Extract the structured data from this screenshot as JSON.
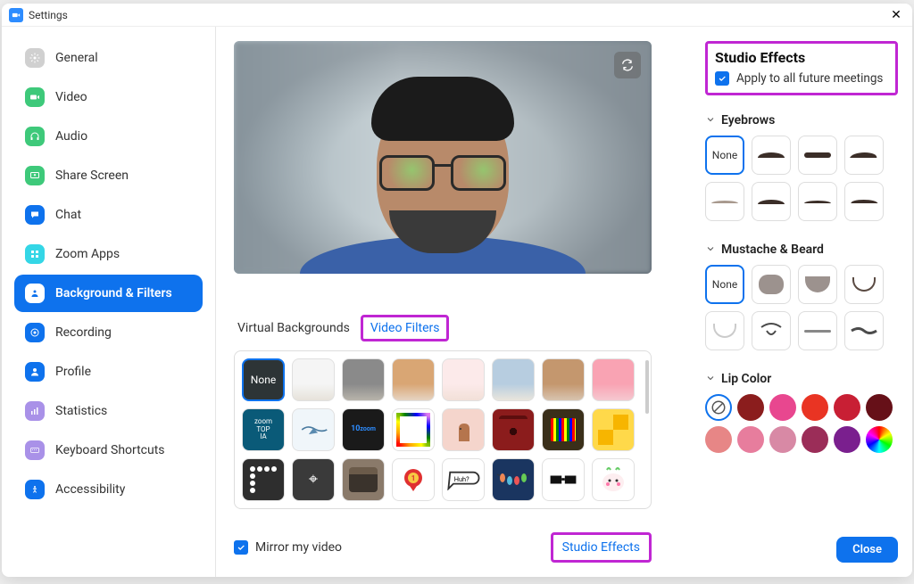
{
  "window": {
    "title": "Settings"
  },
  "sidebar": {
    "items": [
      {
        "label": "General"
      },
      {
        "label": "Video"
      },
      {
        "label": "Audio"
      },
      {
        "label": "Share Screen"
      },
      {
        "label": "Chat"
      },
      {
        "label": "Zoom Apps"
      },
      {
        "label": "Background & Filters"
      },
      {
        "label": "Recording"
      },
      {
        "label": "Profile"
      },
      {
        "label": "Statistics"
      },
      {
        "label": "Keyboard Shortcuts"
      },
      {
        "label": "Accessibility"
      }
    ]
  },
  "tabs": {
    "virtual_backgrounds": "Virtual Backgrounds",
    "video_filters": "Video Filters"
  },
  "filters": {
    "none_label": "None"
  },
  "mirror": {
    "label": "Mirror my video",
    "checked": true
  },
  "studio_link": "Studio Effects",
  "effects": {
    "title": "Studio Effects",
    "apply_label": "Apply to all future meetings",
    "apply_checked": true,
    "sections": {
      "eyebrows": {
        "title": "Eyebrows",
        "none": "None"
      },
      "mustache": {
        "title": "Mustache & Beard",
        "none": "None"
      },
      "lipcolor": {
        "title": "Lip Color"
      }
    },
    "lip_colors": [
      "#8b1d1d",
      "#e8478f",
      "#e93423",
      "#c81f34",
      "#661018",
      "#e78686",
      "#e77d9d",
      "#d889a5",
      "#9b2d58",
      "#7a1f8e"
    ]
  },
  "close_button": "Close"
}
